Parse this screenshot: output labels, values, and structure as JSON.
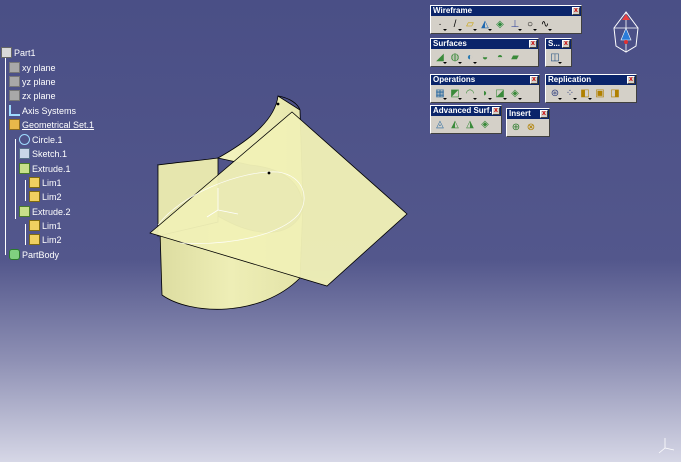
{
  "tree": {
    "root": "Part1",
    "planes": [
      "xy plane",
      "yz plane",
      "zx plane"
    ],
    "axis_systems": "Axis Systems",
    "geometrical_set": "Geometrical Set.1",
    "circle": "Circle.1",
    "sketch": "Sketch.1",
    "extrude1": "Extrude.1",
    "extrude1_children": [
      "Lim1",
      "Lim2"
    ],
    "extrude2": "Extrude.2",
    "extrude2_children": [
      "Lim1",
      "Lim2"
    ],
    "part_body": "PartBody"
  },
  "toolbars": {
    "wireframe": {
      "title": "Wireframe",
      "icons": [
        "point-icon",
        "line-icon",
        "plane-icon",
        "projection-icon",
        "intersection-icon",
        "axis-icon",
        "circle-icon",
        "spline-icon"
      ]
    },
    "surfaces": {
      "title": "Surfaces",
      "icons": [
        "extrude-icon",
        "revolve-icon",
        "sphere-icon",
        "offset-icon",
        "sweep-icon",
        "fill-icon",
        "multisection-icon"
      ]
    },
    "small": {
      "title": "S...",
      "icons": [
        "sketch-icon"
      ]
    },
    "operations": {
      "title": "Operations",
      "icons": [
        "join-icon",
        "split-icon",
        "fillet-icon",
        "translate-icon",
        "extrapolate-icon",
        "boundary-icon"
      ]
    },
    "replication": {
      "title": "Replication",
      "icons": [
        "object-repetition-icon",
        "rectangular-pattern-icon",
        "power-copy-icon",
        "catalog-icon",
        "user-feature-icon"
      ]
    },
    "advanced": {
      "title": "Advanced Surf...",
      "icons": [
        "bump-icon",
        "wrap-curve-icon",
        "shape-morphing-icon",
        "develop-icon"
      ]
    },
    "insert": {
      "title": "Insert",
      "icons": [
        "geometrical-set-icon",
        "ordered-set-icon"
      ]
    }
  },
  "colors": {
    "surface_fill": "#f2f2b8",
    "surface_edge": "#000000",
    "tree_text": "#ffffff",
    "toolbar_title": "#0a246a"
  }
}
